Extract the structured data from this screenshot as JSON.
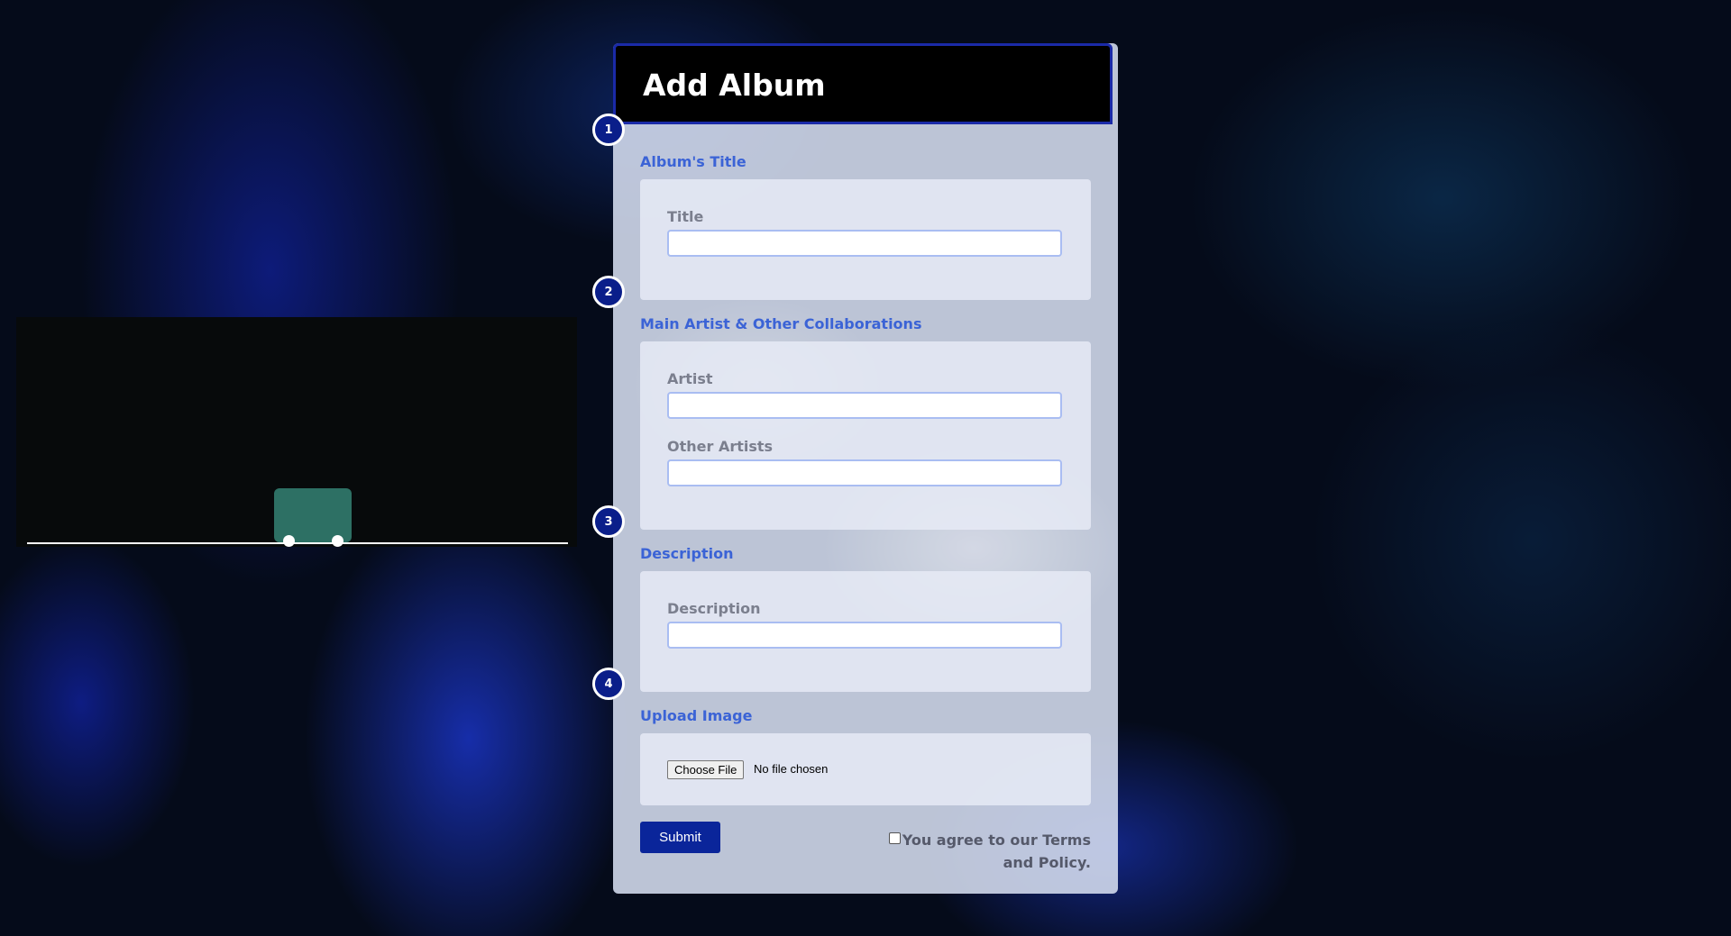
{
  "form": {
    "title": "Add Album",
    "sections": [
      {
        "step": "1",
        "label": "Album's Title",
        "fields": [
          {
            "label": "Title",
            "value": "",
            "placeholder": ""
          }
        ]
      },
      {
        "step": "2",
        "label": "Main Artist & Other Collaborations",
        "fields": [
          {
            "label": "Artist",
            "value": "",
            "placeholder": ""
          },
          {
            "label": "Other Artists",
            "value": "",
            "placeholder": ""
          }
        ]
      },
      {
        "step": "3",
        "label": "Description",
        "fields": [
          {
            "label": "Description",
            "value": "",
            "placeholder": ""
          }
        ]
      },
      {
        "step": "4",
        "label": "Upload Image",
        "file_button_label": "Choose File",
        "file_status": "No file chosen"
      }
    ],
    "submit_label": "Submit",
    "terms_text": "You agree to our Terms and Policy.",
    "terms_checked": false
  },
  "game": {
    "cart_icon": "cart-icon"
  },
  "colors": {
    "accent": "#3b63d6",
    "header_bg": "#000000",
    "header_border": "#1a2aa8",
    "step_marker": "#0a1e8a",
    "submit_bg": "#0a259a",
    "cart": "#2d7064",
    "canvas_bg": "#070a0b"
  }
}
